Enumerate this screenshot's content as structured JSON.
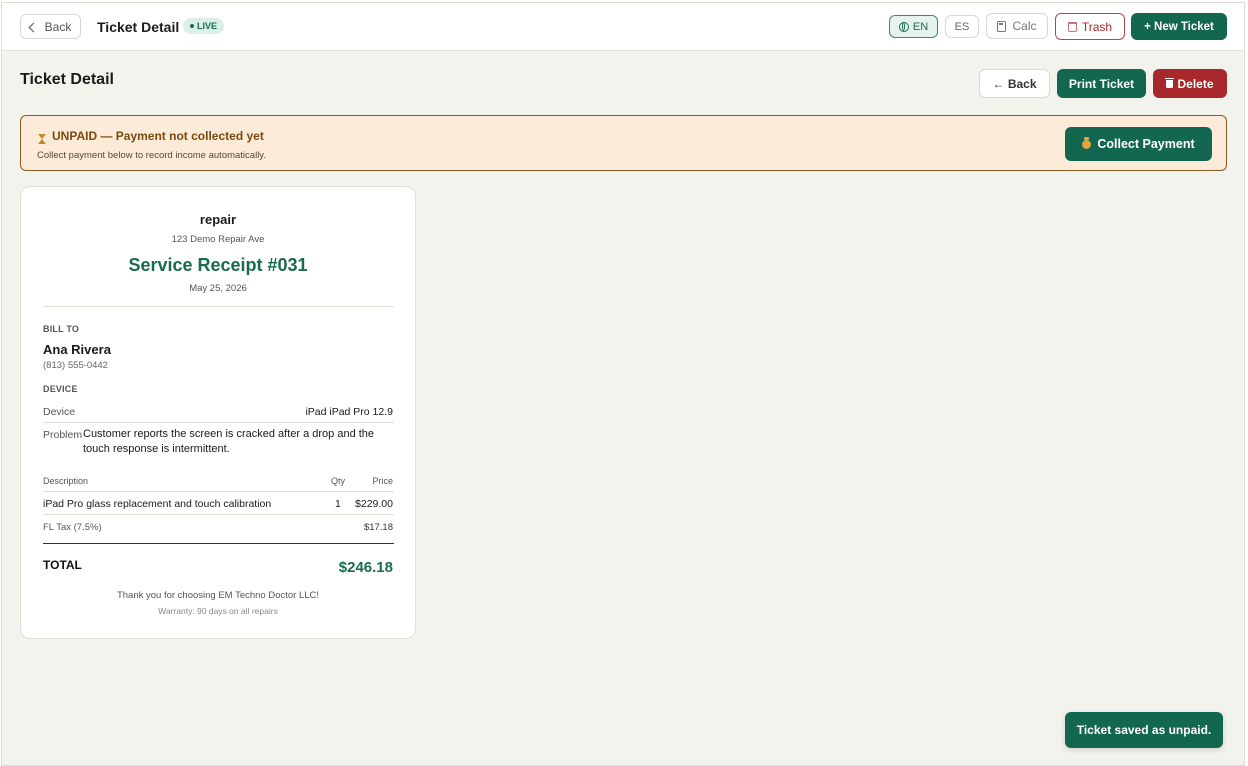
{
  "topbar": {
    "back_label": "Back",
    "title": "Ticket Detail",
    "live_badge": "LIVE",
    "lang_en": "EN",
    "lang_es": "ES",
    "calc_label": "Calc",
    "trash_label": "Trash",
    "new_ticket_label": "+ New Ticket"
  },
  "header": {
    "title": "Ticket Detail",
    "back_label": "← Back",
    "print_label": "Print Ticket",
    "delete_label": "Delete"
  },
  "banner": {
    "title": "UNPAID — Payment not collected yet",
    "subtitle": "Collect payment below to record income automatically.",
    "collect_label": "Collect Payment"
  },
  "receipt": {
    "shop_name": "repair",
    "shop_address": "123 Demo Repair Ave",
    "title": "Service Receipt #031",
    "date": "May 25, 2026",
    "bill_to_label": "BILL TO",
    "customer_name": "Ana Rivera",
    "customer_phone": "(813) 555-0442",
    "device_label": "DEVICE",
    "device_key": "Device",
    "device_value": "iPad iPad Pro 12.9",
    "problem_key": "Problem",
    "problem_value": "Customer reports the screen is cracked after a drop and the touch response is intermittent.",
    "columns": {
      "description": "Description",
      "qty": "Qty",
      "price": "Price"
    },
    "items": [
      {
        "description": "iPad Pro glass replacement and touch calibration",
        "qty": "1",
        "price": "$229.00"
      }
    ],
    "tax_label": "FL Tax (7.5%)",
    "tax_value": "$17.18",
    "total_label": "TOTAL",
    "total_value": "$246.18",
    "thanks": "Thank you for choosing EM Techno Doctor LLC!",
    "warranty": "Warranty: 90 days on all repairs"
  },
  "toast": {
    "message": "Ticket saved as unpaid."
  },
  "colors": {
    "brand_green": "#13664f",
    "danger_red": "#a8272a",
    "unpaid_bg": "#fbebd8",
    "page_bg": "#f3f3ee"
  }
}
